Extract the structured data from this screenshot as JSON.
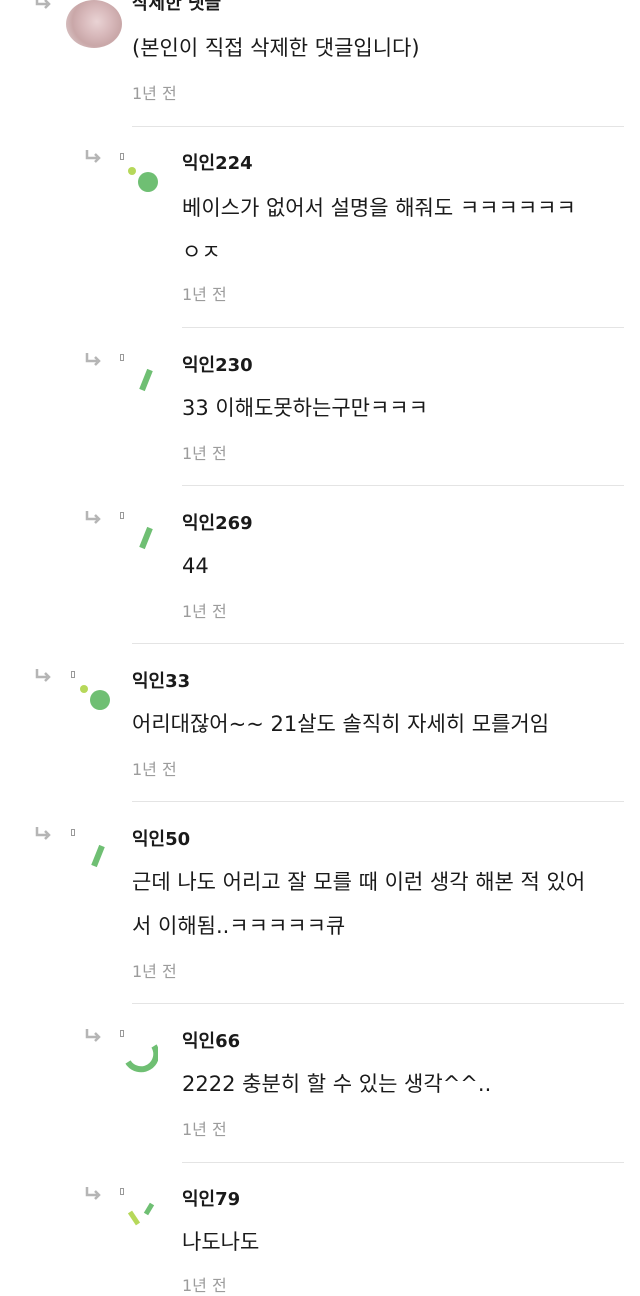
{
  "comments": [
    {
      "nickname": "삭제한 댓글",
      "text": "(본인이 직접 삭제한 댓글입니다)",
      "time": "1년 전",
      "avatar": "photo"
    },
    {
      "nickname": "익인224",
      "text": "베이스가 없어서 설명을 해줘도 ㅋㅋㅋㅋㅋㅋ\nㅇㅈ",
      "time": "1년 전",
      "avatar": "dots-green"
    },
    {
      "nickname": "익인230",
      "text": "33 이해도못하는구만ㅋㅋㅋ",
      "time": "1년 전",
      "avatar": "slash-green"
    },
    {
      "nickname": "익인269",
      "text": "44",
      "time": "1년 전",
      "avatar": "slash-green"
    },
    {
      "nickname": "익인33",
      "text": "어리대잖어~~ 21살도 솔직히 자세히 모를거임",
      "time": "1년 전",
      "avatar": "dots-green"
    },
    {
      "nickname": "익인50",
      "text": "근데 나도 어리고 잘 모를 때 이런 생각 해본 적 있어\n서 이해됨..ㅋㅋㅋㅋㅋ큐",
      "time": "1년 전",
      "avatar": "slash-green"
    },
    {
      "nickname": "익인66",
      "text": "2222 충분히 할 수 있는 생각^^..",
      "time": "1년 전",
      "avatar": "arc-green"
    },
    {
      "nickname": "익인79",
      "text": "나도나도",
      "time": "1년 전",
      "avatar": "sticks-lime"
    }
  ],
  "colors": {
    "avatar_green": "#6fbf73",
    "avatar_lime": "#b6d85a",
    "divider": "#e4e4e4",
    "meta_text": "#9c9c9c"
  }
}
